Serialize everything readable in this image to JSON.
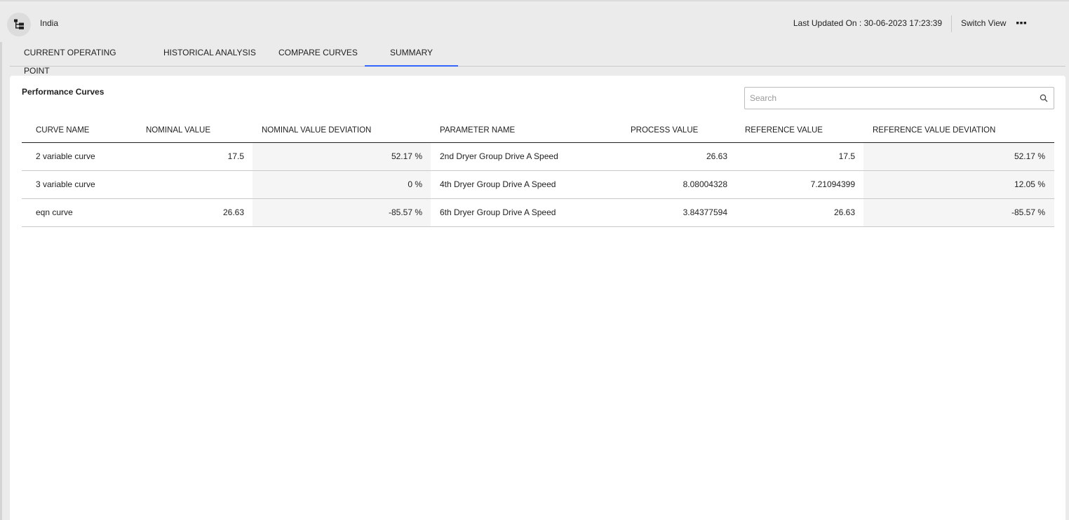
{
  "header": {
    "site_name": "India",
    "last_updated": "Last Updated On : 30-06-2023 17:23:39",
    "switch_view": "Switch View"
  },
  "tabs": [
    {
      "label": "CURRENT OPERATING POINT",
      "active": false
    },
    {
      "label": "HISTORICAL ANALYSIS",
      "active": false
    },
    {
      "label": "COMPARE CURVES",
      "active": false
    },
    {
      "label": "SUMMARY",
      "active": true
    }
  ],
  "card": {
    "title": "Performance Curves",
    "search_placeholder": "Search",
    "search_value": ""
  },
  "table": {
    "columns": [
      "CURVE NAME",
      "NOMINAL VALUE",
      "NOMINAL VALUE DEVIATION",
      "PARAMETER NAME",
      "PROCESS VALUE",
      "REFERENCE VALUE",
      "REFERENCE VALUE DEVIATION"
    ],
    "rows": [
      [
        "2 variable curve",
        "17.5",
        "52.17 %",
        "2nd Dryer Group Drive A Speed",
        "26.63",
        "17.5",
        "52.17 %"
      ],
      [
        "3 variable curve",
        "",
        "0 %",
        "4th Dryer Group Drive A Speed",
        "8.08004328",
        "7.21094399",
        "12.05 %"
      ],
      [
        "eqn curve",
        "26.63",
        "-85.57 %",
        "6th Dryer Group Drive A Speed",
        "3.84377594",
        "26.63",
        "-85.57 %"
      ]
    ]
  },
  "colors": {
    "accent": "#3366ff",
    "background": "#ebebeb",
    "card": "#ffffff",
    "shaded_column": "#f5f5f5"
  },
  "icons": {
    "hierarchy": "hierarchy-icon",
    "more": "more-horizontal-icon",
    "search": "search-icon"
  }
}
